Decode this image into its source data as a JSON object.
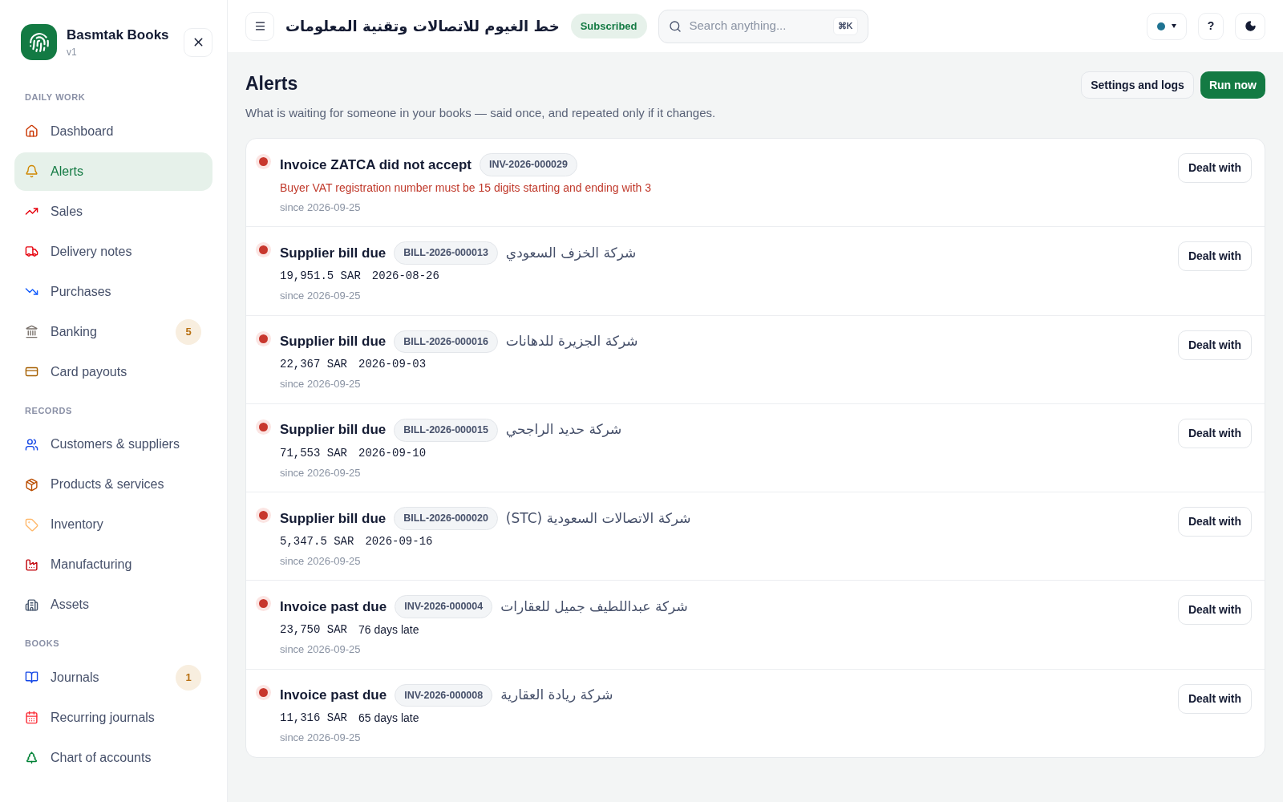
{
  "app": {
    "name": "Basmtak Books",
    "version": "v1"
  },
  "sidebar": {
    "sections": [
      {
        "title": "DAILY WORK",
        "items": [
          {
            "label": "Dashboard",
            "selected": false
          },
          {
            "label": "Alerts",
            "selected": true
          },
          {
            "label": "Sales",
            "selected": false
          },
          {
            "label": "Delivery notes",
            "selected": false
          },
          {
            "label": "Purchases",
            "selected": false
          },
          {
            "label": "Banking",
            "selected": false,
            "badge": "5"
          },
          {
            "label": "Card payouts",
            "selected": false
          }
        ]
      },
      {
        "title": "RECORDS",
        "items": [
          {
            "label": "Customers & suppliers",
            "selected": false
          },
          {
            "label": "Products & services",
            "selected": false
          },
          {
            "label": "Inventory",
            "selected": false
          },
          {
            "label": "Manufacturing",
            "selected": false
          },
          {
            "label": "Assets",
            "selected": false
          }
        ]
      },
      {
        "title": "BOOKS",
        "items": [
          {
            "label": "Journals",
            "selected": false,
            "badge": "1"
          },
          {
            "label": "Recurring journals",
            "selected": false
          },
          {
            "label": "Chart of accounts",
            "selected": false
          }
        ]
      }
    ]
  },
  "header": {
    "company": "خط الغيوم للاتصالات وتقنية المعلومات",
    "plan": "Subscribed",
    "search": {
      "placeholder": "Search anything...",
      "shortcut": "⌘K"
    },
    "help": "?"
  },
  "page": {
    "title": "Alerts",
    "subtitle": "What is waiting for someone in your books — said once, and repeated only if it changes.",
    "buttons": [
      {
        "label": "Settings and logs",
        "kind": "secondary"
      },
      {
        "label": "Run now",
        "kind": "primary"
      }
    ]
  },
  "alerts": [
    {
      "kind": "error",
      "title": "Invoice ZATCA did not accept",
      "code": "INV-2026-000029",
      "message": "Buyer VAT registration number must be 15 digits starting and ending with 3",
      "since": "since 2026-09-25",
      "action": "Dealt with"
    },
    {
      "kind": "bill",
      "title": "Supplier bill due",
      "code": "BILL-2026-000013",
      "party": "شركة الخزف السعودي",
      "amount": "19,951.5 SAR",
      "due_date": "2026-08-26",
      "since": "since 2026-09-25",
      "action": "Dealt with"
    },
    {
      "kind": "bill",
      "title": "Supplier bill due",
      "code": "BILL-2026-000016",
      "party": "شركة الجزيرة للدهانات",
      "amount": "22,367 SAR",
      "due_date": "2026-09-03",
      "since": "since 2026-09-25",
      "action": "Dealt with"
    },
    {
      "kind": "bill",
      "title": "Supplier bill due",
      "code": "BILL-2026-000015",
      "party": "شركة حديد الراجحي",
      "amount": "71,553 SAR",
      "due_date": "2026-09-10",
      "since": "since 2026-09-25",
      "action": "Dealt with"
    },
    {
      "kind": "bill",
      "title": "Supplier bill due",
      "code": "BILL-2026-000020",
      "party": "شركة الاتصالات السعودية (STC)",
      "amount": "5,347.5 SAR",
      "due_date": "2026-09-16",
      "since": "since 2026-09-25",
      "action": "Dealt with"
    },
    {
      "kind": "invoice",
      "title": "Invoice past due",
      "code": "INV-2026-000004",
      "party": "شركة عبداللطيف جميل للعقارات",
      "amount": "23,750 SAR",
      "days_late": "76 days late",
      "since": "since 2026-09-25",
      "action": "Dealt with"
    },
    {
      "kind": "invoice",
      "title": "Invoice past due",
      "code": "INV-2026-000008",
      "party": "شركة ريادة العقارية",
      "amount": "11,316 SAR",
      "days_late": "65 days late",
      "since": "since 2026-09-25",
      "action": "Dealt with"
    }
  ]
}
